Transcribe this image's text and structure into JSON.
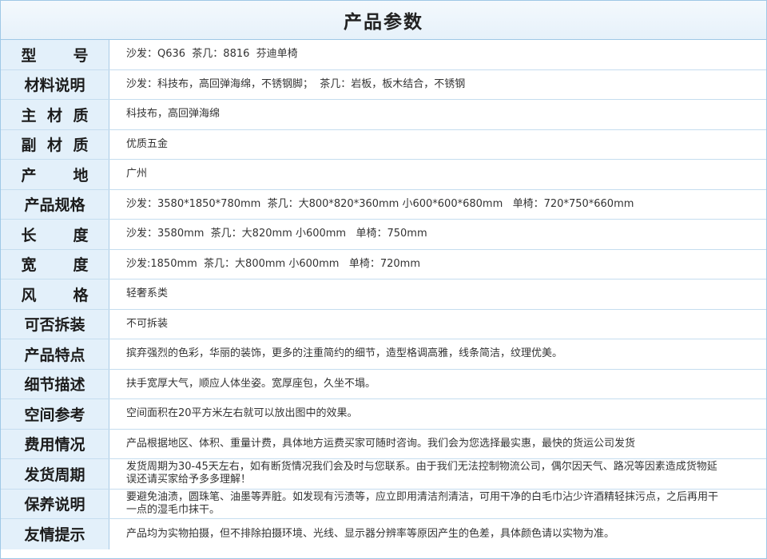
{
  "title": "产品参数",
  "rows": [
    {
      "label": "型  号",
      "value": "沙发：Q636  茶几：8816  芬迪单椅"
    },
    {
      "label": "材料说明",
      "value": "沙发：科技布，高回弹海绵，不锈钢脚；  茶几：岩板，板木结合，不锈钢"
    },
    {
      "label": "主 材 质",
      "value": "科技布，高回弹海绵"
    },
    {
      "label": "副 材 质",
      "value": "优质五金"
    },
    {
      "label": "产  地",
      "value": "广州"
    },
    {
      "label": "产品规格",
      "value": "沙发：3580*1850*780mm  茶几：大800*820*360mm 小600*600*680mm   单椅：720*750*660mm"
    },
    {
      "label": "长  度",
      "value": "沙发：3580mm  茶几：大820mm 小600mm   单椅：750mm"
    },
    {
      "label": "宽  度",
      "value": "沙发:1850mm  茶几：大800mm 小600mm   单椅：720mm"
    },
    {
      "label": "风  格",
      "value": "轻奢系类"
    },
    {
      "label": "可否拆装",
      "value": "不可拆装"
    },
    {
      "label": "产品特点",
      "value": "摈弃强烈的色彩，华丽的装饰，更多的注重简约的细节，造型格调高雅，线条简洁，纹理优美。"
    },
    {
      "label": "细节描述",
      "value": "扶手宽厚大气，顺应人体坐姿。宽厚座包，久坐不塌。"
    },
    {
      "label": "空间参考",
      "value": "空间面积在20平方米左右就可以放出图中的效果。"
    },
    {
      "label": "费用情况",
      "value": "产品根据地区、体积、重量计费，具体地方运费买家可随时咨询。我们会为您选择最实惠，最快的货运公司发货"
    },
    {
      "label": "发货周期",
      "value": "发货周期为30-45天左右，如有断货情况我们会及时与您联系。由于我们无法控制物流公司，偶尔因天气、路况等因素造成货物延误还请买家给予多多理解！"
    },
    {
      "label": "保养说明",
      "value": "要避免油渍，圆珠笔、油墨等弄脏。如发现有污渍等，应立即用清洁剂清洁，可用干净的白毛巾沾少许酒精轻抹污点，之后再用干一点的湿毛巾抹干。"
    },
    {
      "label": "友情提示",
      "value": "产品均为实物拍摄，但不排除拍摄环境、光线、显示器分辨率等原因产生的色差，具体颜色请以实物为准。"
    }
  ]
}
